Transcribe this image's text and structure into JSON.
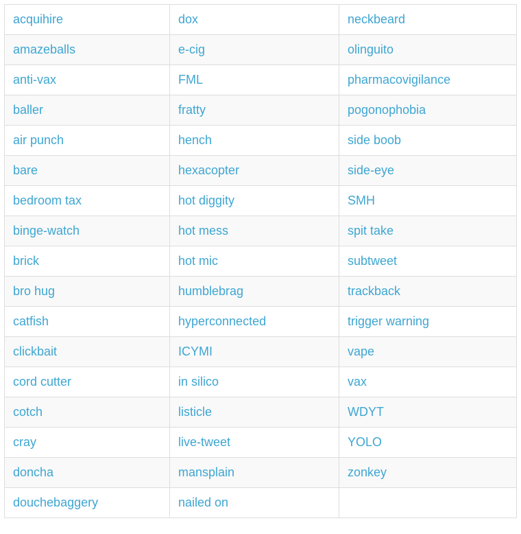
{
  "colors": {
    "link": "#3ea6d2",
    "border": "#dddddd",
    "stripe": "#f9f9f9"
  },
  "rows": [
    [
      "acquihire",
      "dox",
      "neckbeard"
    ],
    [
      "amazeballs",
      "e-cig",
      "olinguito"
    ],
    [
      "anti-vax",
      "FML",
      "pharmacovigilance"
    ],
    [
      "baller",
      "fratty",
      "pogonophobia"
    ],
    [
      "air punch",
      "hench",
      "side boob"
    ],
    [
      "bare",
      "hexacopter",
      "side-eye"
    ],
    [
      "bedroom tax",
      "hot diggity",
      "SMH"
    ],
    [
      "binge-watch",
      "hot mess",
      "spit take"
    ],
    [
      "brick",
      "hot mic",
      "subtweet"
    ],
    [
      "bro hug",
      "humblebrag",
      "trackback"
    ],
    [
      "catfish",
      "hyperconnected",
      "trigger warning"
    ],
    [
      "clickbait",
      "ICYMI",
      "vape"
    ],
    [
      "cord cutter",
      "in silico",
      "vax"
    ],
    [
      "cotch",
      "listicle",
      "WDYT"
    ],
    [
      "cray",
      "live-tweet",
      "YOLO"
    ],
    [
      "doncha",
      "mansplain",
      "zonkey"
    ],
    [
      "douchebaggery",
      "nailed on",
      ""
    ]
  ]
}
